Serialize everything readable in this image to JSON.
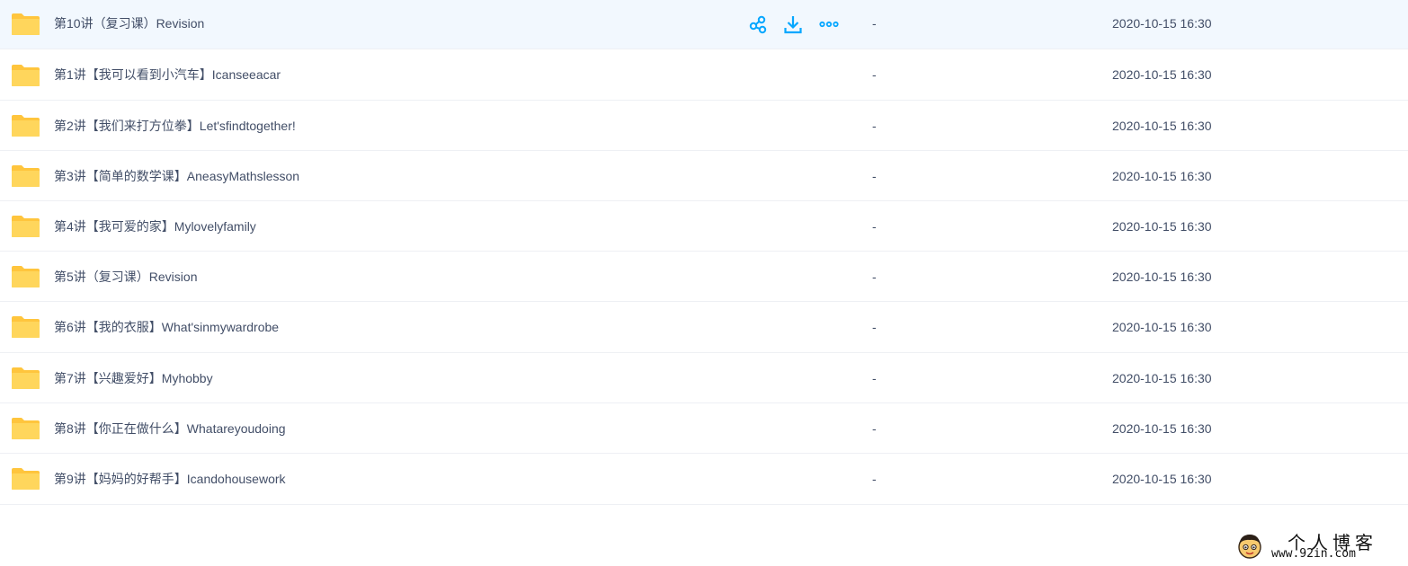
{
  "files": [
    {
      "name": "第10讲（复习课）Revision",
      "size": "-",
      "modified": "2020-10-15 16:30",
      "selected": true
    },
    {
      "name": "第1讲【我可以看到小汽车】Icanseeacar",
      "size": "-",
      "modified": "2020-10-15 16:30"
    },
    {
      "name": "第2讲【我们来打方位拳】Let'sfindtogether!",
      "size": "-",
      "modified": "2020-10-15 16:30"
    },
    {
      "name": "第3讲【简单的数学课】AneasyMathslesson",
      "size": "-",
      "modified": "2020-10-15 16:30"
    },
    {
      "name": "第4讲【我可爱的家】Mylovelyfamily",
      "size": "-",
      "modified": "2020-10-15 16:30"
    },
    {
      "name": "第5讲（复习课）Revision",
      "size": "-",
      "modified": "2020-10-15 16:30"
    },
    {
      "name": "第6讲【我的衣服】What'sinmywardrobe",
      "size": "-",
      "modified": "2020-10-15 16:30"
    },
    {
      "name": "第7讲【兴趣爱好】Myhobby",
      "size": "-",
      "modified": "2020-10-15 16:30"
    },
    {
      "name": "第8讲【你正在做什么】Whatareyoudoing",
      "size": "-",
      "modified": "2020-10-15 16:30"
    },
    {
      "name": "第9讲【妈妈的好帮手】Icandohousework",
      "size": "-",
      "modified": "2020-10-15 16:30"
    }
  ],
  "row_actions": [
    {
      "icon": "share-icon"
    },
    {
      "icon": "download-icon"
    },
    {
      "icon": "more-icon"
    }
  ],
  "watermark": {
    "title": "个人博客",
    "url": "www.92in.com"
  },
  "colors": {
    "accent": "#06a7ff",
    "folder": "#ffd65c",
    "folder_tab": "#ffc53d",
    "text": "#424e67",
    "selected_row": "#f2f8fe",
    "divider": "#eef0f4"
  }
}
